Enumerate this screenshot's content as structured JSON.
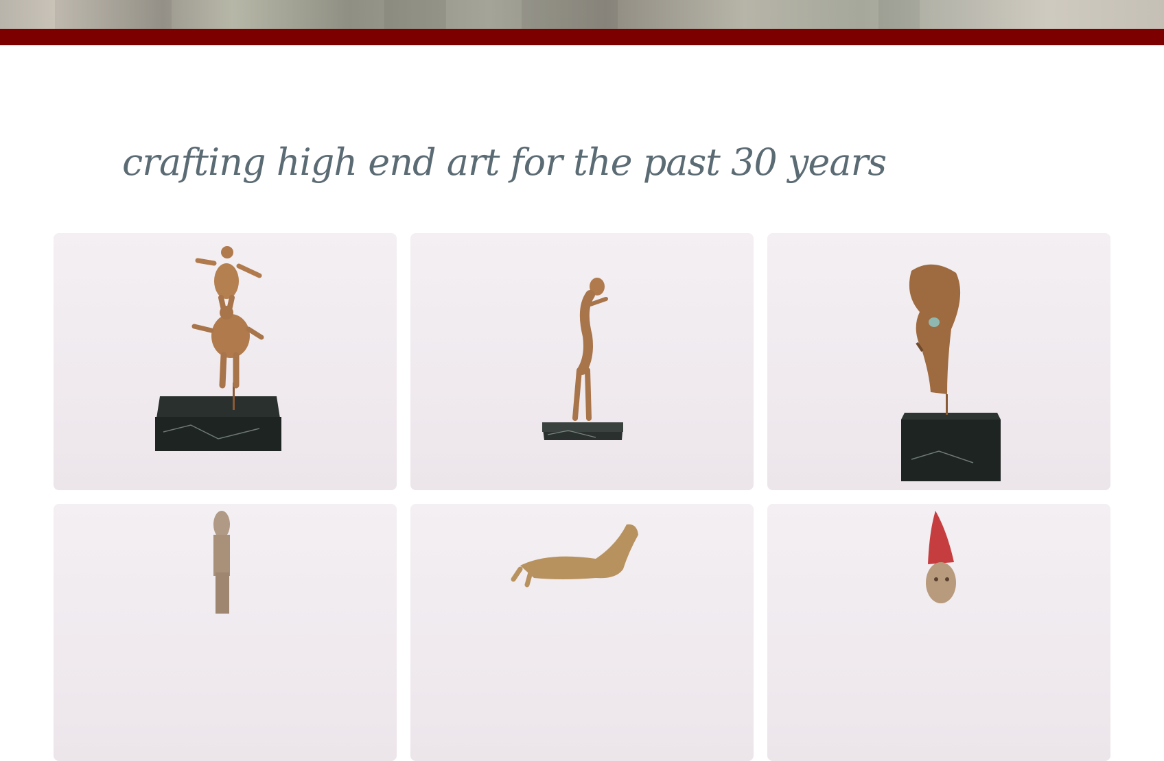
{
  "tagline": "crafting high end art for the past 30 years",
  "gallery": {
    "items": [
      {
        "icon": "stacked-figures-sculpture-photo"
      },
      {
        "icon": "dancing-figure-sculpture-photo"
      },
      {
        "icon": "face-mask-sculpture-photo"
      },
      {
        "icon": "totem-sculpture-photo"
      },
      {
        "icon": "horse-sculpture-photo"
      },
      {
        "icon": "red-hat-figure-sculpture-photo"
      }
    ]
  },
  "colors": {
    "accent_bar": "#7c0000",
    "tagline_text": "#5b6b74",
    "bronze": "#b07a4c",
    "marble": "#1e2422",
    "card_bg": "#f1ecf0"
  }
}
